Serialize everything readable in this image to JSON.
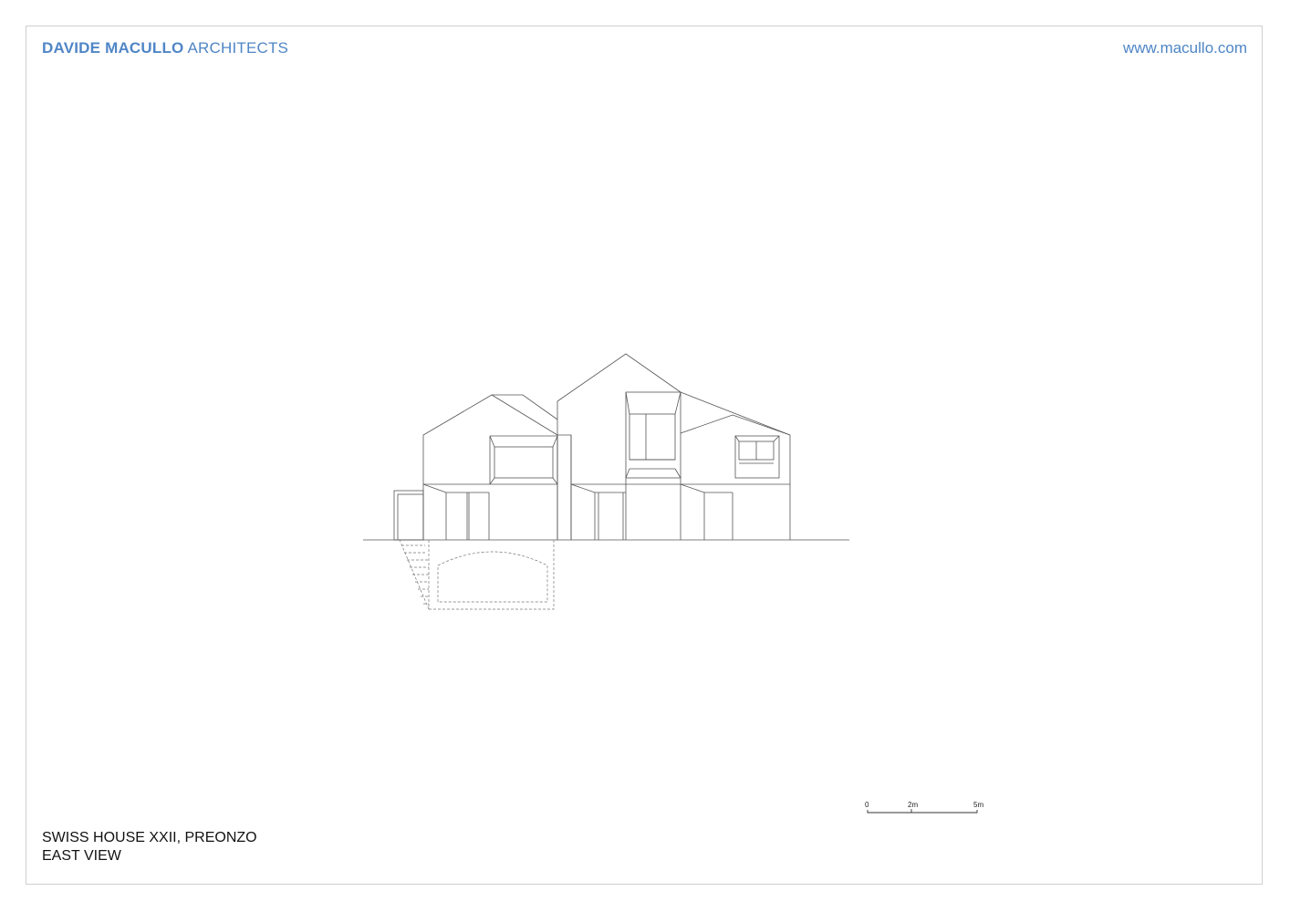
{
  "header": {
    "brand_bold": "DAVIDE MACULLO",
    "brand_light": "ARCHITECTS",
    "website": "www.macullo.com",
    "accent_color": "#4f86c6"
  },
  "title_block": {
    "project": "SWISS HOUSE XXII, PREONZO",
    "view": "EAST VIEW"
  },
  "scale_bar": {
    "labels": [
      "0",
      "2m",
      "5m"
    ]
  }
}
